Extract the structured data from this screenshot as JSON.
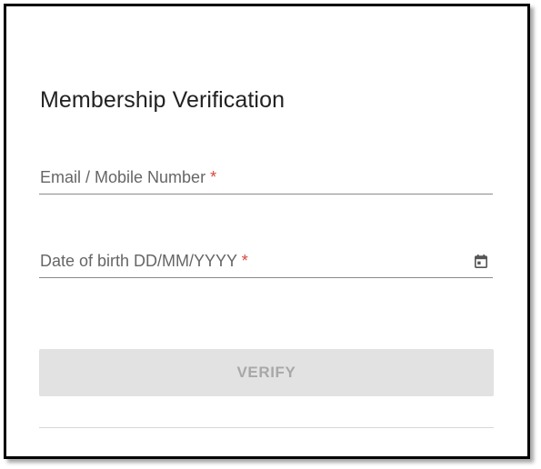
{
  "form": {
    "title": "Membership Verification",
    "email_field": {
      "label": "Email / Mobile Number",
      "required_mark": "*",
      "value": ""
    },
    "dob_field": {
      "label": "Date of birth DD/MM/YYYY",
      "required_mark": "*",
      "value": "",
      "icon": "calendar-icon"
    },
    "verify_button": {
      "label": "VERIFY",
      "state": "disabled"
    }
  },
  "colors": {
    "border": "#000000",
    "title": "#222222",
    "label": "#666666",
    "required": "#d9453a",
    "underline": "#8a8a8a",
    "button_bg": "#e2e2e2",
    "button_text": "#a8a8a8"
  }
}
